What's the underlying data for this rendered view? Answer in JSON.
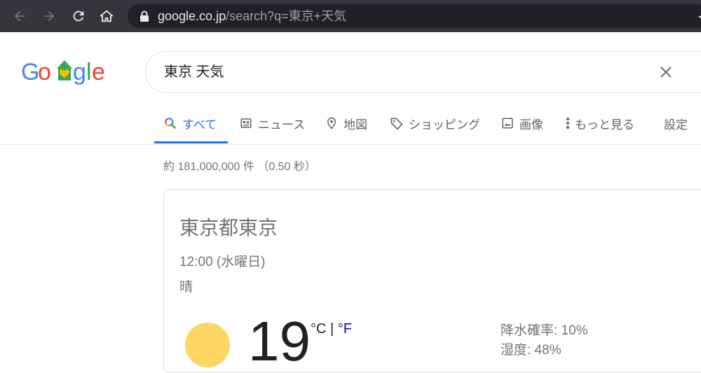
{
  "browser": {
    "url_host": "google.co.jp",
    "url_rest": "/search?q=東京+天気"
  },
  "search": {
    "query": "東京 天気"
  },
  "tabs": [
    {
      "label": "すべて",
      "icon": "search-icon"
    },
    {
      "label": "ニュース",
      "icon": "news-icon"
    },
    {
      "label": "地図",
      "icon": "map-pin-icon"
    },
    {
      "label": "ショッピング",
      "icon": "tag-icon"
    },
    {
      "label": "画像",
      "icon": "image-icon"
    },
    {
      "label": "もっと見る",
      "icon": "more-vert-icon"
    },
    {
      "label": "設定"
    }
  ],
  "results": {
    "stats": "約 181,000,000 件 （0.50 秒）"
  },
  "weather": {
    "location": "東京都東京",
    "time": "12:00 (水曜日)",
    "condition": "晴",
    "temperature": "19",
    "unit_c": "°C",
    "unit_sep": " | ",
    "unit_f": "°F",
    "precipitation": "降水確率: 10%",
    "humidity": "湿度: 48%"
  },
  "colors": {
    "accent": "#1a73e8",
    "chrome_bg": "#35363a",
    "omnibox_bg": "#202124",
    "sun": "#fdd663"
  }
}
